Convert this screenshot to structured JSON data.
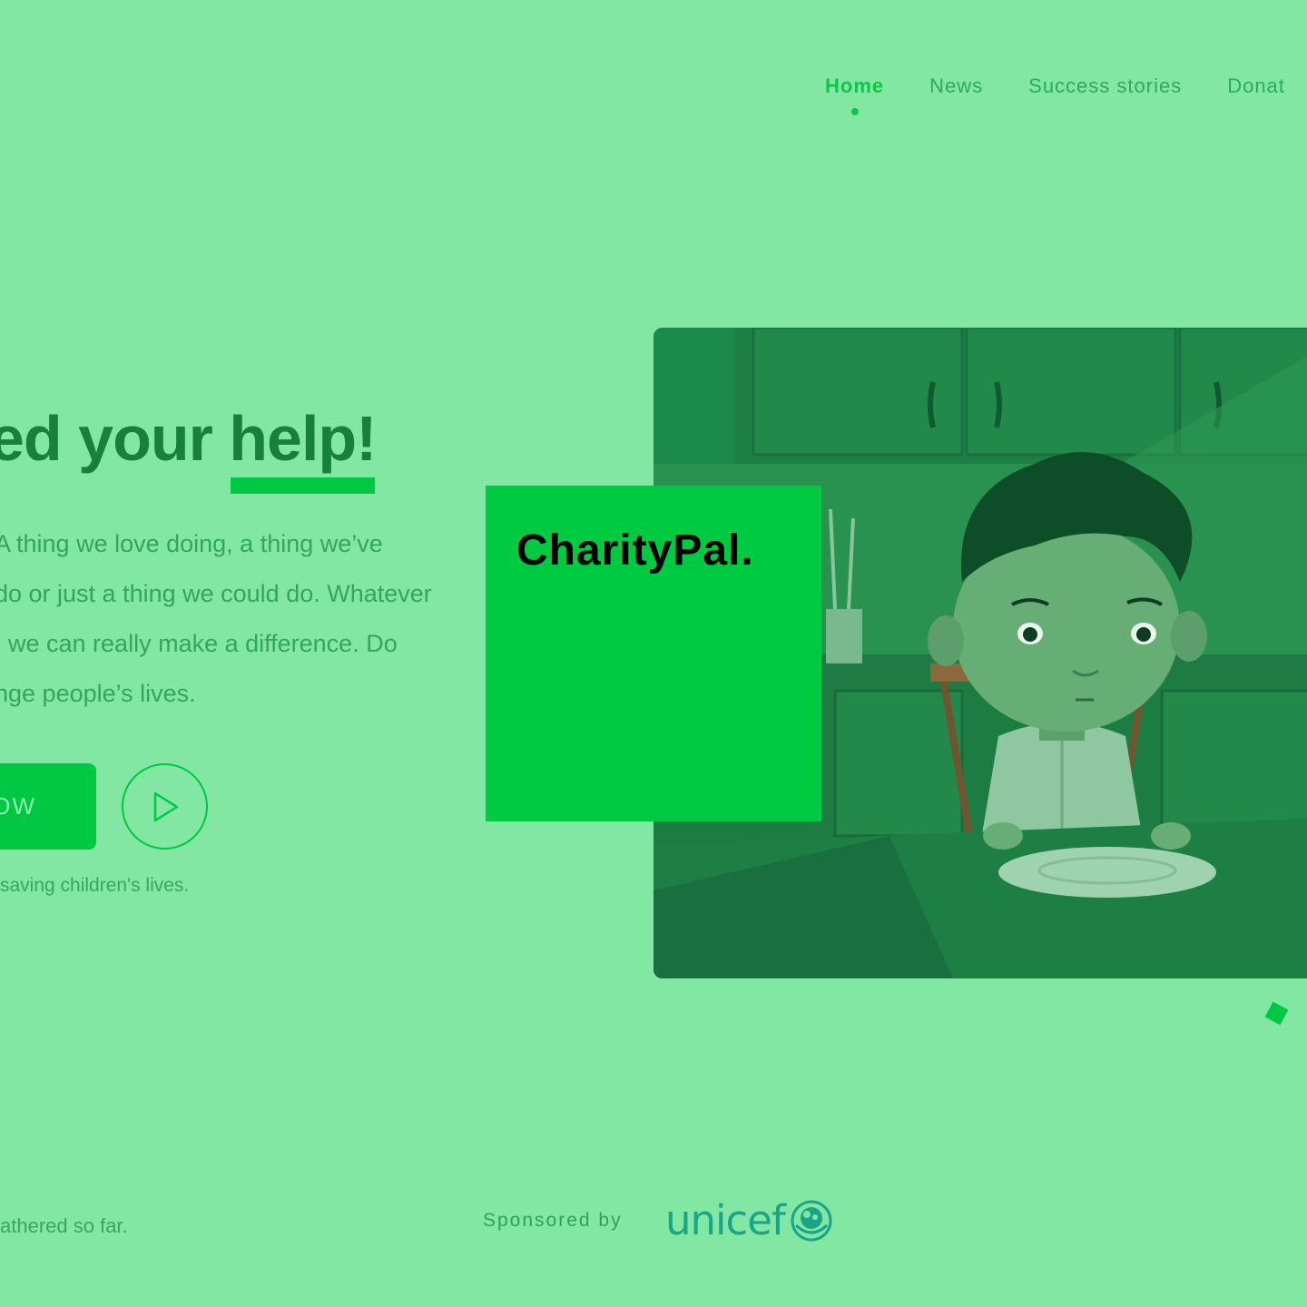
{
  "nav": {
    "items": [
      {
        "label": "Home",
        "active": true
      },
      {
        "label": "News",
        "active": false
      },
      {
        "label": "Success stories",
        "active": false
      },
      {
        "label": "Donat",
        "active": false
      }
    ]
  },
  "hero": {
    "headline_prefix": "ed your ",
    "headline_highlight": "help!",
    "body_lines": [
      "A thing we love doing, a thing we’ve",
      "do or just a thing we could do. Whatever",
      ", we can really make a difference. Do",
      "nge people’s lives."
    ],
    "cta_label": "OW",
    "note": "saving children's lives."
  },
  "logo_card": {
    "brand": "CharityPal."
  },
  "footer": {
    "gathered_text": "athered so far.",
    "sponsored_label": "Sponsored by",
    "sponsor_logo_text": "unicef"
  },
  "colors": {
    "background": "#82e7a2",
    "accent": "#00c842",
    "headline": "#17803c",
    "unicef": "#1aa58a"
  },
  "icons": {
    "play": "play-icon",
    "sponsor": "un-emblem-icon"
  }
}
